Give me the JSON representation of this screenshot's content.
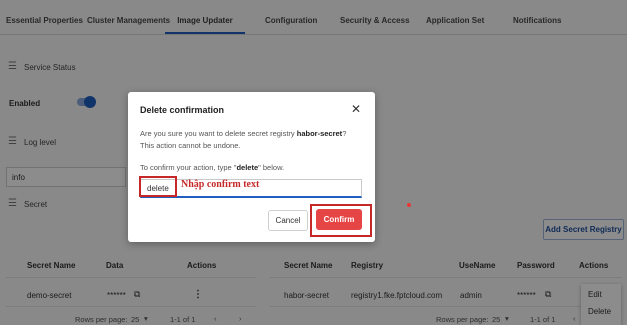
{
  "tabs": [
    {
      "label": "Essential Properties"
    },
    {
      "label": "Cluster Managements"
    },
    {
      "label": "Image Updater"
    },
    {
      "label": "Configuration"
    },
    {
      "label": "Security & Access"
    },
    {
      "label": "Application Set"
    },
    {
      "label": "Notifications"
    }
  ],
  "service_status": {
    "heading": "Service Status",
    "enabled_label": "Enabled",
    "enabled": true
  },
  "log_level": {
    "heading": "Log level",
    "value": "info"
  },
  "secret": {
    "heading": "Secret"
  },
  "add_registry_button": "Add Secret Registry",
  "secret_table": {
    "headers": [
      "Secret Name",
      "Data",
      "Actions"
    ],
    "rows": [
      {
        "name": "demo-secret",
        "data": "******"
      }
    ],
    "footer": {
      "rows_per_page_label": "Rows per page:",
      "rows_per_page": "25",
      "range": "1-1 of 1"
    }
  },
  "registry_table": {
    "headers": [
      "Secret Name",
      "Registry",
      "UseName",
      "Password",
      "Actions"
    ],
    "rows": [
      {
        "name": "habor-secret",
        "registry": "registry1.fke.fptcloud.com",
        "username": "admin",
        "password": "******"
      }
    ],
    "footer": {
      "rows_per_page_label": "Rows per page:",
      "rows_per_page": "25",
      "range": "1-1 of 1"
    }
  },
  "row_menu": {
    "items": [
      "Edit",
      "Delete"
    ]
  },
  "modal": {
    "title": "Delete confirmation",
    "message_prefix": "Are you sure you want to delete secret registry ",
    "secret_name": "habor-secret",
    "message_suffix": "?",
    "undone": "This action cannot be undone.",
    "instruction_prefix": "To confirm your action, type \"",
    "instruction_keyword": "delete",
    "instruction_suffix": "\" below.",
    "input_value": "delete",
    "cancel_label": "Cancel",
    "confirm_label": "Confirm"
  },
  "annotation": {
    "text": "Nhập confirm text"
  },
  "colors": {
    "accent": "#1e5fbf",
    "danger": "#e54545",
    "annotation": "#c62828"
  }
}
